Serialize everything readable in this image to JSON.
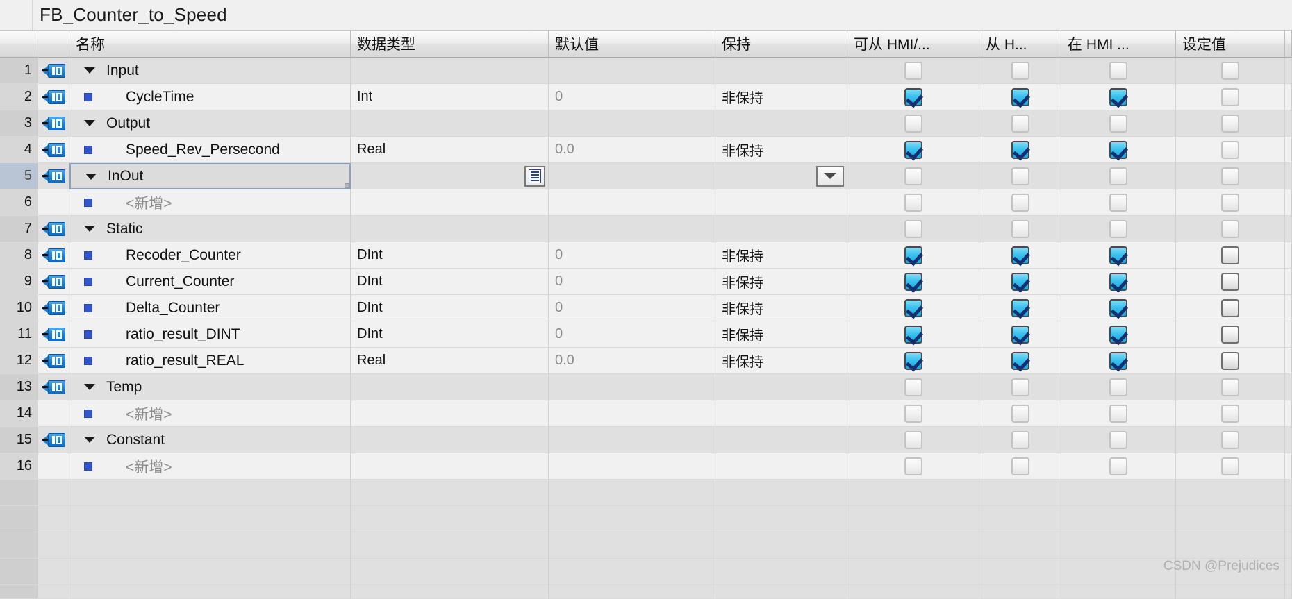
{
  "title": "FB_Counter_to_Speed",
  "watermark": "CSDN @Prejudices",
  "columns": {
    "num": "",
    "tag": "",
    "name": "名称",
    "type": "数据类型",
    "default": "默认值",
    "retain": "保持",
    "hmi_accessible": "可从 HMI/...",
    "hmi_writable": "从 H...",
    "hmi_visible": "在 HMI ...",
    "setpoint": "设定值"
  },
  "icons": {
    "tag": "tag-icon",
    "square": "blue-square-icon",
    "expand": "expand-triangle-icon",
    "browse": "browse-list-icon",
    "dropdown": "chevron-down-icon"
  },
  "values": {
    "nonretentive": "非保持",
    "new_placeholder": "<新增>",
    "zero_int": "0",
    "zero_real": "0.0"
  },
  "rows": [
    {
      "num": "1",
      "kind": "group",
      "tag": true,
      "marker": "expand",
      "name": "Input",
      "type": "",
      "default": "",
      "retain": "",
      "cb": [
        "off",
        "off",
        "off",
        "off"
      ],
      "shade": "dark"
    },
    {
      "num": "2",
      "kind": "item",
      "tag": true,
      "marker": "square",
      "name": "CycleTime",
      "type": "Int",
      "default": "0",
      "retain": "非保持",
      "cb": [
        "on",
        "on",
        "on",
        "off"
      ],
      "shade": "light"
    },
    {
      "num": "3",
      "kind": "group",
      "tag": true,
      "marker": "expand",
      "name": "Output",
      "type": "",
      "default": "",
      "retain": "",
      "cb": [
        "off",
        "off",
        "off",
        "off"
      ],
      "shade": "dark"
    },
    {
      "num": "4",
      "kind": "item",
      "tag": true,
      "marker": "square",
      "name": "Speed_Rev_Persecond",
      "type": "Real",
      "default": "0.0",
      "retain": "非保持",
      "cb": [
        "on",
        "on",
        "on",
        "off"
      ],
      "shade": "light"
    },
    {
      "num": "5",
      "kind": "group",
      "tag": true,
      "marker": "expand",
      "name": "InOut",
      "type": "",
      "default": "",
      "retain": "",
      "cb": [
        "off",
        "off",
        "off",
        "off"
      ],
      "shade": "dark",
      "selected": true,
      "browse": true,
      "dropdown": true
    },
    {
      "num": "6",
      "kind": "new",
      "tag": false,
      "marker": "square",
      "name": "<新增>",
      "type": "",
      "default": "",
      "retain": "",
      "cb": [
        "off",
        "off",
        "off",
        "off"
      ],
      "shade": "light"
    },
    {
      "num": "7",
      "kind": "group",
      "tag": true,
      "marker": "expand",
      "name": "Static",
      "type": "",
      "default": "",
      "retain": "",
      "cb": [
        "off",
        "off",
        "off",
        "off"
      ],
      "shade": "dark"
    },
    {
      "num": "8",
      "kind": "item",
      "tag": true,
      "marker": "square",
      "name": "Recoder_Counter",
      "type": "DInt",
      "default": "0",
      "retain": "非保持",
      "cb": [
        "on",
        "on",
        "on",
        "enabled"
      ],
      "shade": "light"
    },
    {
      "num": "9",
      "kind": "item",
      "tag": true,
      "marker": "square",
      "name": "Current_Counter",
      "type": "DInt",
      "default": "0",
      "retain": "非保持",
      "cb": [
        "on",
        "on",
        "on",
        "enabled"
      ],
      "shade": "light"
    },
    {
      "num": "10",
      "kind": "item",
      "tag": true,
      "marker": "square",
      "name": "Delta_Counter",
      "type": "DInt",
      "default": "0",
      "retain": "非保持",
      "cb": [
        "on",
        "on",
        "on",
        "enabled"
      ],
      "shade": "light"
    },
    {
      "num": "11",
      "kind": "item",
      "tag": true,
      "marker": "square",
      "name": "ratio_result_DINT",
      "type": "DInt",
      "default": "0",
      "retain": "非保持",
      "cb": [
        "on",
        "on",
        "on",
        "enabled"
      ],
      "shade": "light"
    },
    {
      "num": "12",
      "kind": "item",
      "tag": true,
      "marker": "square",
      "name": "ratio_result_REAL",
      "type": "Real",
      "default": "0.0",
      "retain": "非保持",
      "cb": [
        "on",
        "on",
        "on",
        "enabled"
      ],
      "shade": "light"
    },
    {
      "num": "13",
      "kind": "group",
      "tag": true,
      "marker": "expand",
      "name": "Temp",
      "type": "",
      "default": "",
      "retain": "",
      "cb": [
        "off",
        "off",
        "off",
        "off"
      ],
      "shade": "dark"
    },
    {
      "num": "14",
      "kind": "new",
      "tag": false,
      "marker": "square",
      "name": "<新增>",
      "type": "",
      "default": "",
      "retain": "",
      "cb": [
        "off",
        "off",
        "off",
        "off"
      ],
      "shade": "light"
    },
    {
      "num": "15",
      "kind": "group",
      "tag": true,
      "marker": "expand",
      "name": "Constant",
      "type": "",
      "default": "",
      "retain": "",
      "cb": [
        "off",
        "off",
        "off",
        "off"
      ],
      "shade": "dark"
    },
    {
      "num": "16",
      "kind": "new",
      "tag": false,
      "marker": "square",
      "name": "<新增>",
      "type": "",
      "default": "",
      "retain": "",
      "cb": [
        "off",
        "off",
        "off",
        "off"
      ],
      "shade": "light"
    }
  ]
}
